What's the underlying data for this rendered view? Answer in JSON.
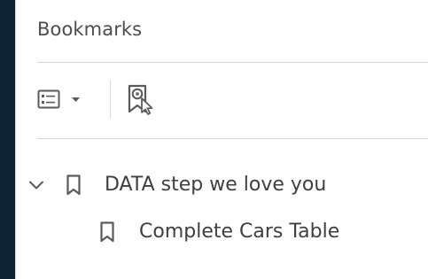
{
  "panel": {
    "title": "Bookmarks"
  },
  "toolbar": {
    "options_icon": "list-options-icon",
    "options_caret_icon": "caret-down-icon",
    "find_icon": "find-current-bookmark-icon"
  },
  "bookmarks": [
    {
      "label": "DATA step we love you",
      "expanded": true,
      "icon": "bookmark-icon",
      "children": [
        {
          "label": "Complete Cars Table",
          "icon": "bookmark-icon"
        }
      ]
    }
  ],
  "colors": {
    "background": "#0d2233",
    "panel": "#ffffff",
    "text": "#3f3f3f",
    "icon": "#5a5a5a"
  }
}
